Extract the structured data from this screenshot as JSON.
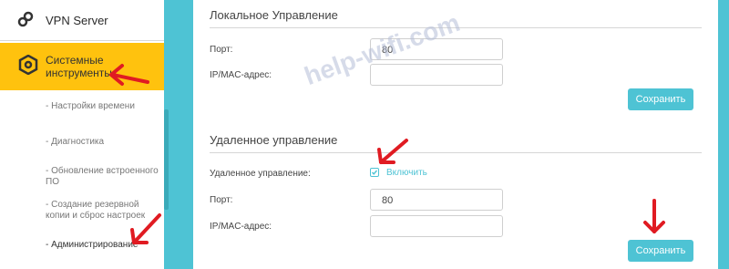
{
  "sidebar": {
    "vpn_label": "VPN Server",
    "active_label": "Системные инструменты",
    "items": [
      {
        "label": "- Настройки времени"
      },
      {
        "label": "- Диагностика"
      },
      {
        "label": "- Обновление встроенного ПО"
      },
      {
        "label": "- Создание резервной копии и сброс настроек"
      },
      {
        "label": "- Администрирование"
      }
    ]
  },
  "local": {
    "title": "Локальное Управление",
    "port_label": "Порт:",
    "port_value": "80",
    "ip_label": "IP/MAC-адрес:",
    "ip_value": "",
    "save_label": "Сохранить"
  },
  "remote": {
    "title": "Удаленное управление",
    "enable_field_label": "Удаленное управление:",
    "enable_checkbox_label": "Включить",
    "enabled": true,
    "port_label": "Порт:",
    "port_value": "80",
    "ip_label": "IP/MAC-адрес:",
    "ip_value": "",
    "save_label": "Сохранить"
  },
  "watermark": "help-wifi.com",
  "colors": {
    "accent": "#4ec3d4",
    "active": "#ffc20e",
    "arrow": "#e01b22"
  }
}
